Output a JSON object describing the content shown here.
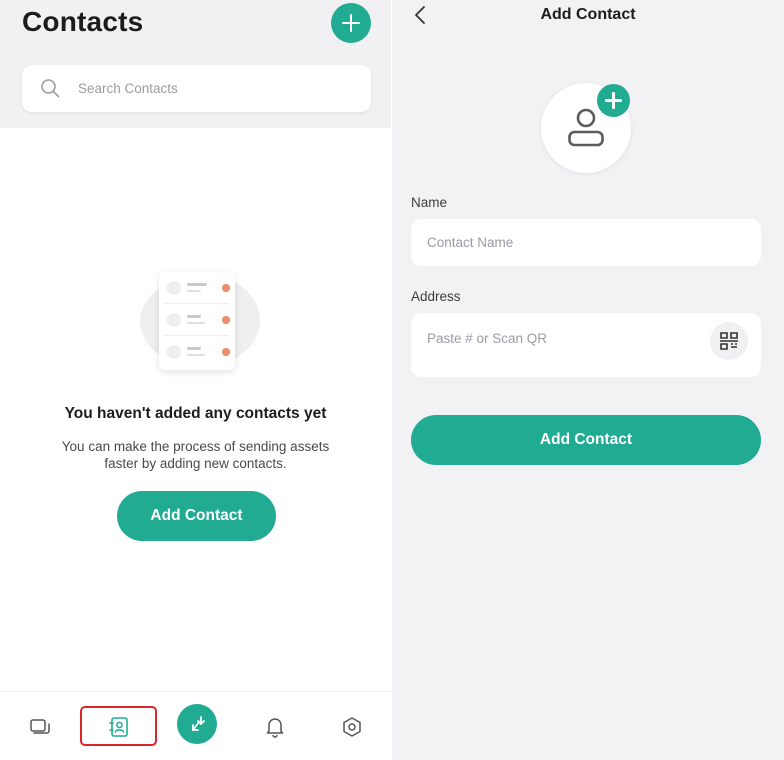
{
  "left_screen": {
    "title": "Contacts",
    "add_button_icon": "plus-icon",
    "search": {
      "icon": "search-icon",
      "placeholder": "Search Contacts"
    },
    "empty_state": {
      "illustration": "contact-list-illustration",
      "title": "You haven't added any contacts yet",
      "description": "You can make the process of sending assets faster by adding new contacts.",
      "button_label": "Add Contact"
    },
    "bottom_nav": {
      "items": [
        {
          "name": "wallets",
          "icon": "wallet-icon",
          "active": false
        },
        {
          "name": "contacts",
          "icon": "contacts-book-icon",
          "active": true
        },
        {
          "name": "transfer",
          "icon": "transfer-arrows-icon",
          "active": false
        },
        {
          "name": "notifications",
          "icon": "bell-icon",
          "active": false
        },
        {
          "name": "settings",
          "icon": "hexagon-settings-icon",
          "active": false
        }
      ]
    }
  },
  "right_screen": {
    "title": "Add Contact",
    "back_icon": "chevron-left-icon",
    "avatar_icon": "user-icon",
    "avatar_add_icon": "plus-icon",
    "name_field": {
      "label": "Name",
      "placeholder": "Contact Name"
    },
    "address_field": {
      "label": "Address",
      "placeholder": "Paste # or Scan QR",
      "scan_icon": "qr-scan-icon"
    },
    "submit_label": "Add Contact"
  },
  "colors": {
    "accent": "#21ab92",
    "highlight_outline": "#d9262c",
    "illustration_dot": "#e88c6c",
    "left_header_bg": "#f1f1f3",
    "right_bg": "#f2f2f5"
  }
}
